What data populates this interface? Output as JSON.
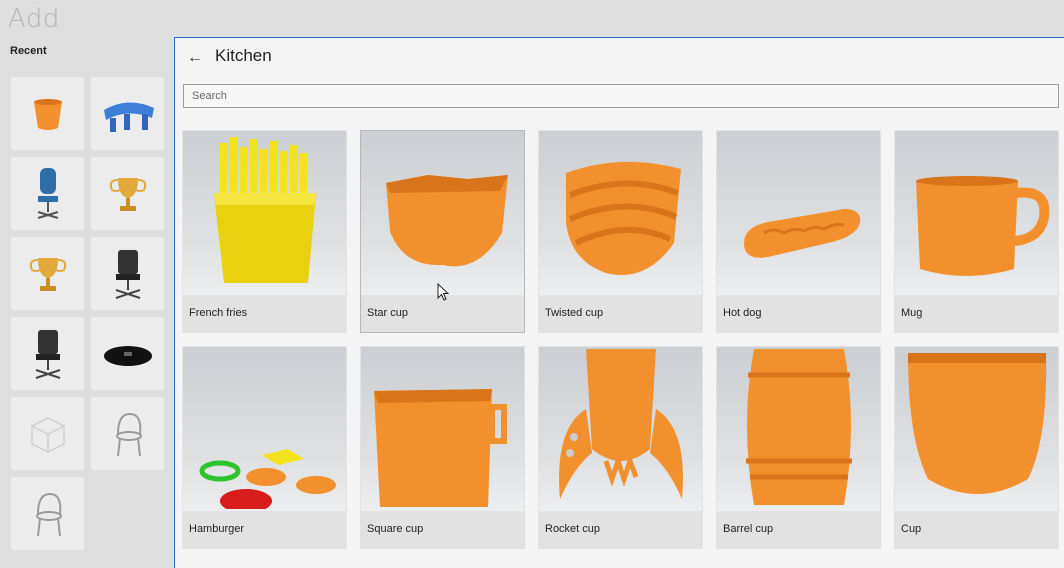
{
  "app": {
    "title": "Add"
  },
  "recent": {
    "label": "Recent",
    "items": [
      {
        "icon": "cup-icon"
      },
      {
        "icon": "blue-bench-icon"
      },
      {
        "icon": "blue-chair-icon"
      },
      {
        "icon": "trophy-icon"
      },
      {
        "icon": "trophy-icon"
      },
      {
        "icon": "office-chair-icon"
      },
      {
        "icon": "office-chair-icon"
      },
      {
        "icon": "black-disc-icon"
      },
      {
        "icon": "cube-placeholder-icon"
      },
      {
        "icon": "wire-chair-icon"
      },
      {
        "icon": "wire-chair-icon"
      }
    ]
  },
  "panel": {
    "title": "Kitchen",
    "back_icon": "back-arrow-icon",
    "search_placeholder": "Search"
  },
  "models": [
    {
      "label": "French fries",
      "icon": "french-fries-icon"
    },
    {
      "label": "Star cup",
      "icon": "star-cup-icon"
    },
    {
      "label": "Twisted cup",
      "icon": "twisted-cup-icon"
    },
    {
      "label": "Hot dog",
      "icon": "hot-dog-icon"
    },
    {
      "label": "Mug",
      "icon": "mug-icon"
    },
    {
      "label": "Hamburger",
      "icon": "hamburger-icon"
    },
    {
      "label": "Square cup",
      "icon": "square-cup-icon"
    },
    {
      "label": "Rocket cup",
      "icon": "rocket-cup-icon"
    },
    {
      "label": "Barrel cup",
      "icon": "barrel-cup-icon"
    },
    {
      "label": "Cup",
      "icon": "cup-icon"
    }
  ],
  "colors": {
    "accent": "#2b6cc4",
    "model_orange": "#f2902e",
    "fries_yellow": "#f3e21c"
  }
}
